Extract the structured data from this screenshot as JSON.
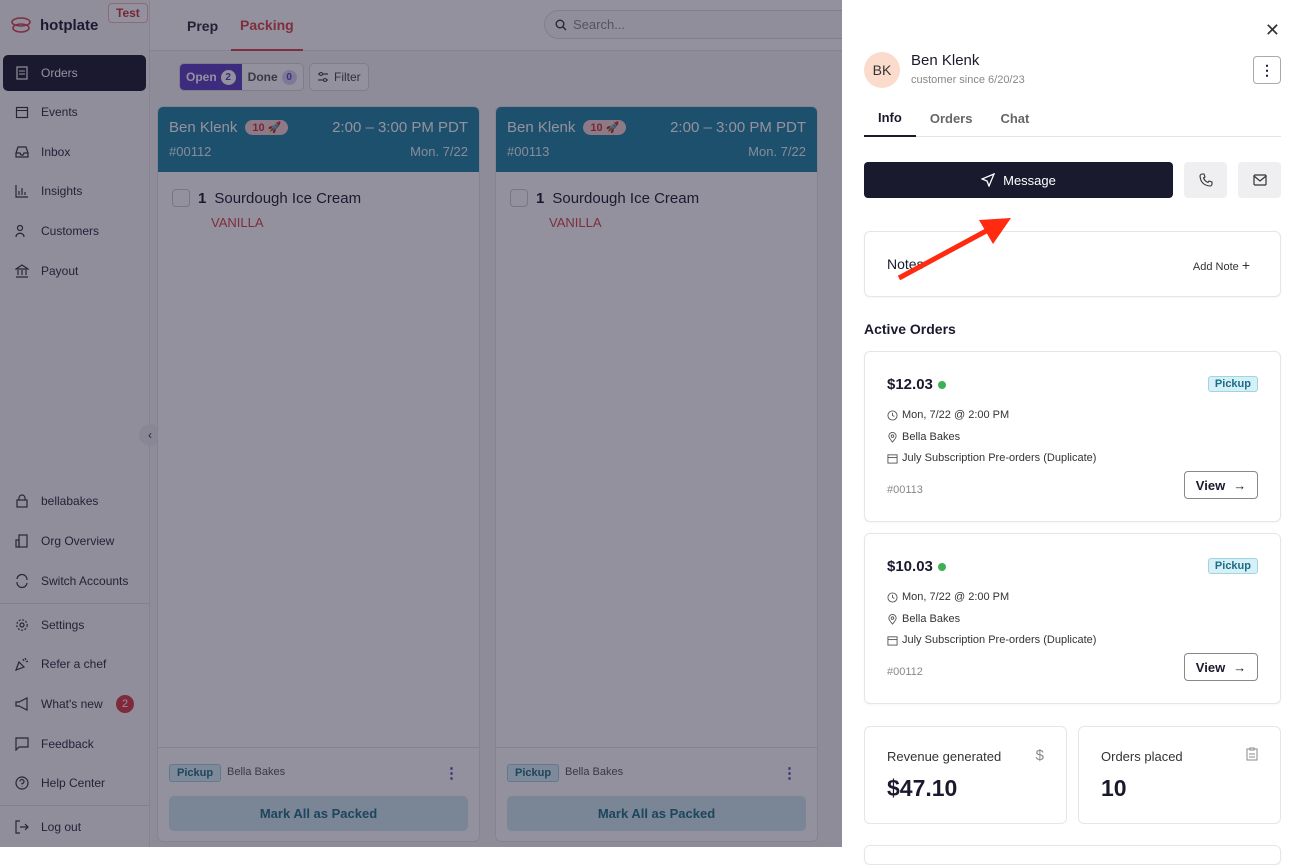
{
  "brand": {
    "name": "hotplate",
    "env_badge": "Test"
  },
  "sidebar": {
    "items": [
      {
        "label": "Orders",
        "icon": "receipt-icon",
        "active": true
      },
      {
        "label": "Events",
        "icon": "calendar-icon"
      },
      {
        "label": "Inbox",
        "icon": "inbox-icon"
      },
      {
        "label": "Insights",
        "icon": "bar-chart-icon"
      },
      {
        "label": "Customers",
        "icon": "users-icon"
      },
      {
        "label": "Payout",
        "icon": "bank-icon"
      }
    ],
    "account": [
      {
        "label": "bellabakes",
        "icon": "lock-icon"
      },
      {
        "label": "Org Overview",
        "icon": "building-icon"
      },
      {
        "label": "Switch Accounts",
        "icon": "refresh-icon"
      }
    ],
    "misc": [
      {
        "label": "Settings",
        "icon": "gear-icon"
      },
      {
        "label": "Refer a chef",
        "icon": "party-popper-icon"
      },
      {
        "label": "What's new",
        "icon": "megaphone-icon",
        "badge": "2"
      },
      {
        "label": "Feedback",
        "icon": "message-square-icon"
      },
      {
        "label": "Help Center",
        "icon": "help-circle-icon"
      }
    ],
    "logout": "Log out"
  },
  "header": {
    "tabs": [
      "Prep",
      "Packing"
    ],
    "active_tab": "Packing",
    "search_placeholder": "Search..."
  },
  "filters": {
    "open_label": "Open",
    "open_count": "2",
    "done_label": "Done",
    "done_count": "0",
    "filter_label": "Filter"
  },
  "orders": [
    {
      "customer": "Ben Klenk",
      "badge": "10 🚀",
      "time": "2:00 – 3:00 PM PDT",
      "id": "#00112",
      "date": "Mon. 7/22",
      "qty": "1",
      "item": "Sourdough Ice Cream",
      "variant": "VANILLA",
      "type": "Pickup",
      "location": "Bella Bakes",
      "action": "Mark All as Packed"
    },
    {
      "customer": "Ben Klenk",
      "badge": "10 🚀",
      "time": "2:00 – 3:00 PM PDT",
      "id": "#00113",
      "date": "Mon. 7/22",
      "qty": "1",
      "item": "Sourdough Ice Cream",
      "variant": "VANILLA",
      "type": "Pickup",
      "location": "Bella Bakes",
      "action": "Mark All as Packed"
    }
  ],
  "panel": {
    "initials": "BK",
    "name": "Ben Klenk",
    "since": "customer since 6/20/23",
    "tabs": [
      "Info",
      "Orders",
      "Chat"
    ],
    "active_tab": "Info",
    "message_label": "Message",
    "notes_title": "Notes",
    "add_note": "Add Note",
    "active_orders_title": "Active Orders",
    "active_orders": [
      {
        "amount": "$12.03",
        "type": "Pickup",
        "when": "Mon, 7/22 @ 2:00 PM",
        "location": "Bella Bakes",
        "event": "July Subscription Pre-orders (Duplicate)",
        "id": "#00113",
        "view": "View"
      },
      {
        "amount": "$10.03",
        "type": "Pickup",
        "when": "Mon, 7/22 @ 2:00 PM",
        "location": "Bella Bakes",
        "event": "July Subscription Pre-orders (Duplicate)",
        "id": "#00112",
        "view": "View"
      }
    ],
    "stats": [
      {
        "label": "Revenue generated",
        "value": "$47.10",
        "icon": "$"
      },
      {
        "label": "Orders placed",
        "value": "10",
        "icon": "clipboard-icon"
      }
    ]
  },
  "colors": {
    "accent": "#d9414a",
    "primary": "#5b3fc4",
    "header_teal": "#1e83a3",
    "annotation_arrow": "#ff2a10"
  }
}
